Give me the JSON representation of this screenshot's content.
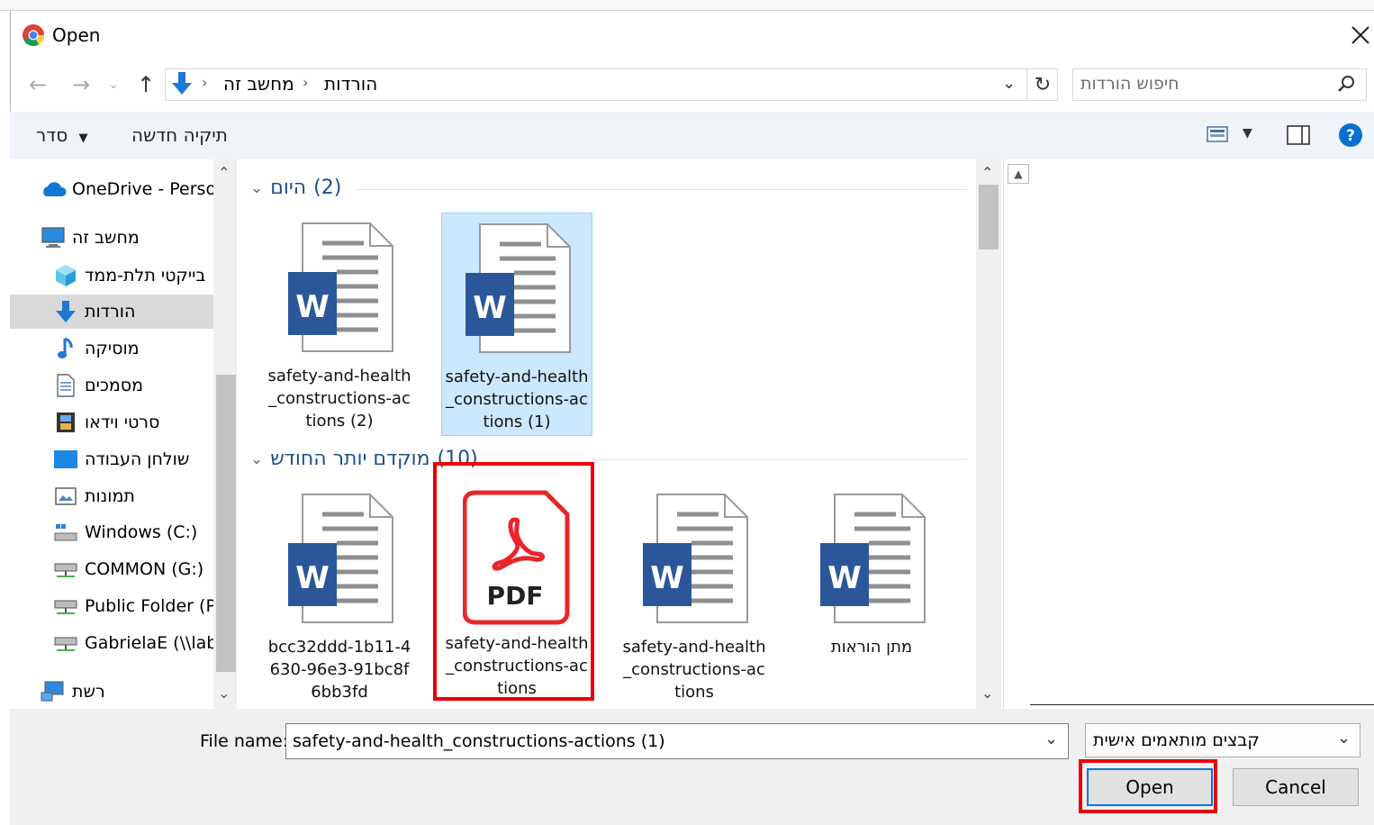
{
  "window": {
    "title": "Open"
  },
  "address": {
    "crumbs": [
      "מחשב זה",
      "הורדות"
    ],
    "search_placeholder": "חיפוש הורדות"
  },
  "toolbar": {
    "organize": "סדר",
    "new_folder": "תיקיה חדשה"
  },
  "nav": {
    "items": [
      {
        "label": "OneDrive - Persor",
        "icon": "cloud-icon"
      },
      {
        "label": "מחשב זה",
        "icon": "computer-icon"
      },
      {
        "label": "בייקטי תלת-ממד",
        "icon": "cube-3d-icon"
      },
      {
        "label": "הורדות",
        "icon": "download-arrow-icon"
      },
      {
        "label": "מוסיקה",
        "icon": "music-note-icon"
      },
      {
        "label": "מסמכים",
        "icon": "document-icon"
      },
      {
        "label": "סרטי וידאו",
        "icon": "film-icon"
      },
      {
        "label": "שולחן העבודה",
        "icon": "desktop-icon"
      },
      {
        "label": "תמונות",
        "icon": "pictures-icon"
      },
      {
        "label": "Windows (C:)",
        "icon": "drive-icon"
      },
      {
        "label": "COMMON (G:)",
        "icon": "network-drive-icon"
      },
      {
        "label": "Public Folder (P:",
        "icon": "network-drive-icon"
      },
      {
        "label": "GabrielaE (\\\\labc",
        "icon": "network-drive-icon"
      },
      {
        "label": "רשת",
        "icon": "network-icon"
      }
    ]
  },
  "groups": [
    {
      "name": "היום",
      "count": "(2)",
      "files": [
        {
          "name": "safety-and-health_constructions-actions (2)",
          "type": "word"
        },
        {
          "name": "safety-and-health_constructions-actions (1)",
          "type": "word"
        }
      ]
    },
    {
      "name": "מוקדם יותר החודש",
      "count": "(10)",
      "files": [
        {
          "name": "bcc32ddd-1b11-4630-96e3-91bc8f6bb3fd",
          "type": "word"
        },
        {
          "name": "safety-and-health_constructions-actions",
          "type": "pdf"
        },
        {
          "name": "safety-and-health_constructions-actions",
          "type": "word"
        },
        {
          "name": "מתן הוראות",
          "type": "word"
        }
      ]
    }
  ],
  "bottom": {
    "file_name_label": "File name:",
    "file_name_value": "safety-and-health_constructions-actions (1)",
    "filter": "קבצים מותאמים אישית",
    "open": "Open",
    "cancel": "Cancel"
  },
  "icons": {
    "word_letter": "W",
    "pdf_label": "PDF"
  },
  "colors": {
    "word_blue": "#2b579a",
    "pdf_red": "#e8252a",
    "highlight": "#e8000b",
    "group_blue": "#1e4e8c",
    "selection": "#cce8ff"
  }
}
